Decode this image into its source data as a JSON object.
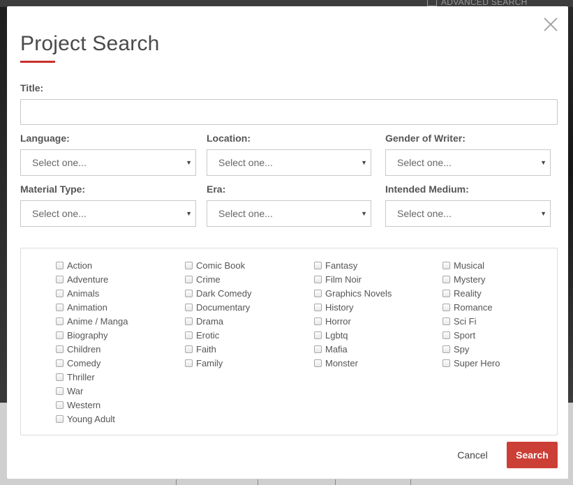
{
  "backdrop": {
    "advanced_search_label": "ADVANCED SEARCH"
  },
  "modal": {
    "title": "Project Search",
    "close_icon": "close-icon",
    "accent_color": "#cc3f37",
    "title_field": {
      "label": "Title:",
      "value": "",
      "placeholder": ""
    },
    "filters": {
      "language": {
        "label": "Language:",
        "value": "Select one..."
      },
      "location": {
        "label": "Location:",
        "value": "Select one..."
      },
      "gender_of_writer": {
        "label": "Gender of Writer:",
        "value": "Select one..."
      },
      "material_type": {
        "label": "Material Type:",
        "value": "Select one..."
      },
      "era": {
        "label": "Era:",
        "value": "Select one..."
      },
      "intended_medium": {
        "label": "Intended Medium:",
        "value": "Select one..."
      }
    },
    "genres": {
      "col1": [
        "Action",
        "Adventure",
        "Animals",
        "Animation",
        "Anime / Manga",
        "Biography",
        "Children",
        "Comedy",
        "Thriller",
        "War",
        "Western",
        "Young Adult"
      ],
      "col2": [
        "Comic Book",
        "Crime",
        "Dark Comedy",
        "Documentary",
        "Drama",
        "Erotic",
        "Faith",
        "Family"
      ],
      "col3": [
        "Fantasy",
        "Film Noir",
        "Graphics Novels",
        "History",
        "Horror",
        "Lgbtq",
        "Mafia",
        "Monster"
      ],
      "col4": [
        "Musical",
        "Mystery",
        "Reality",
        "Romance",
        "Sci Fi",
        "Sport",
        "Spy",
        "Super Hero"
      ]
    },
    "actions": {
      "cancel_label": "Cancel",
      "search_label": "Search"
    }
  }
}
